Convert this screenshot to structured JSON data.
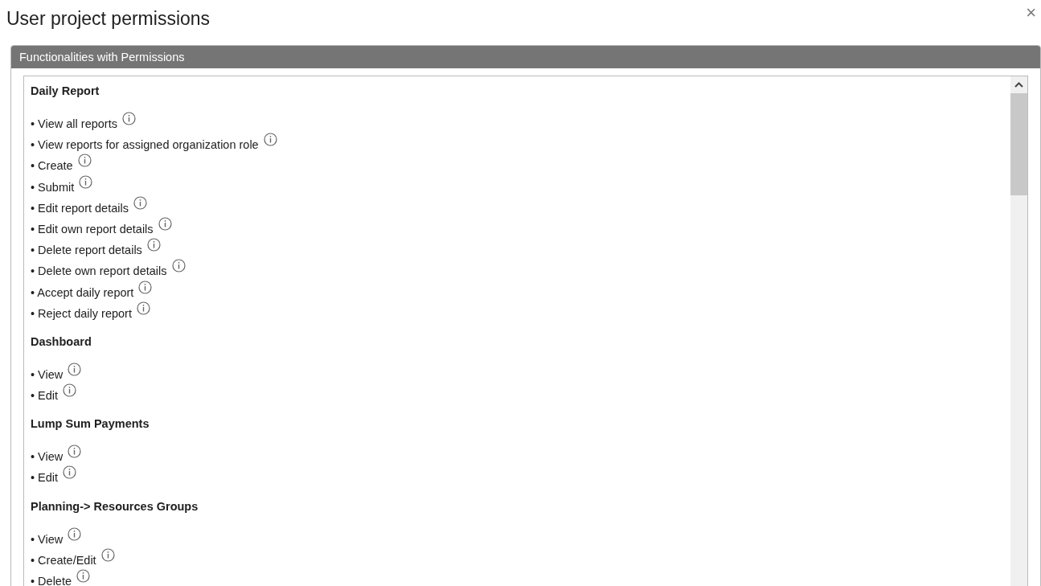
{
  "dialog": {
    "title": "User project permissions",
    "close": "×"
  },
  "panel": {
    "header": "Functionalities with Permissions",
    "groups": [
      {
        "title": "Daily Report",
        "items": [
          "• View all reports",
          "• View reports for assigned organization role",
          "• Create",
          "• Submit",
          "• Edit report details",
          "• Edit own report details",
          "• Delete report details",
          "• Delete own report details",
          "• Accept daily report",
          "• Reject daily report"
        ]
      },
      {
        "title": "Dashboard",
        "items": [
          "• View",
          "• Edit"
        ]
      },
      {
        "title": "Lump Sum Payments",
        "items": [
          "• View",
          "• Edit"
        ]
      },
      {
        "title": "Planning-> Resources Groups",
        "items": [
          "• View",
          "• Create/Edit",
          "• Delete"
        ]
      }
    ]
  }
}
